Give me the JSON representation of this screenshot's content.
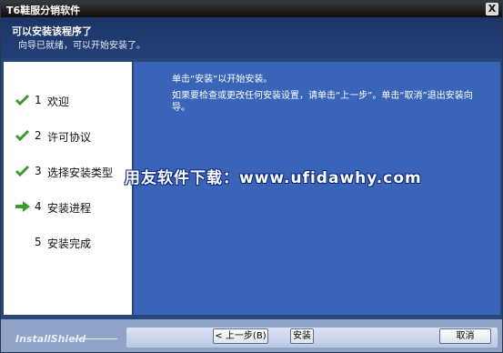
{
  "window": {
    "title": "T6鞋服分销软件",
    "close_glyph": "X"
  },
  "header": {
    "title": "可以安装该程序了",
    "subtitle": "向导已就绪，可以开始安装了。"
  },
  "steps": [
    {
      "number": "1",
      "label": "欢迎",
      "status": "done",
      "icon": "checkmark-icon"
    },
    {
      "number": "2",
      "label": "许可协议",
      "status": "done",
      "icon": "checkmark-icon"
    },
    {
      "number": "3",
      "label": "选择安装类型",
      "status": "done",
      "icon": "checkmark-icon"
    },
    {
      "number": "4",
      "label": "安装进程",
      "status": "current",
      "icon": "arrow-right-icon"
    },
    {
      "number": "5",
      "label": "安装完成",
      "status": "pending",
      "icon": ""
    }
  ],
  "content": {
    "line1": "单击“安装”以开始安装。",
    "line2": "如果要检查或更改任何安装设置，请单击“上一步”。单击“取消”退出安装向",
    "line3": "导。"
  },
  "watermark": "用友软件下载：www.ufidawhy.com",
  "footer": {
    "brand": "InstallShield",
    "back_label": "< 上一步(B)",
    "install_label": "安装",
    "cancel_label": "取消"
  },
  "colors": {
    "header_bg": "#243f78",
    "content_bg": "#3a64b8",
    "check_green": "#3c9a2e",
    "footer_bg": "#8ea3c6"
  }
}
